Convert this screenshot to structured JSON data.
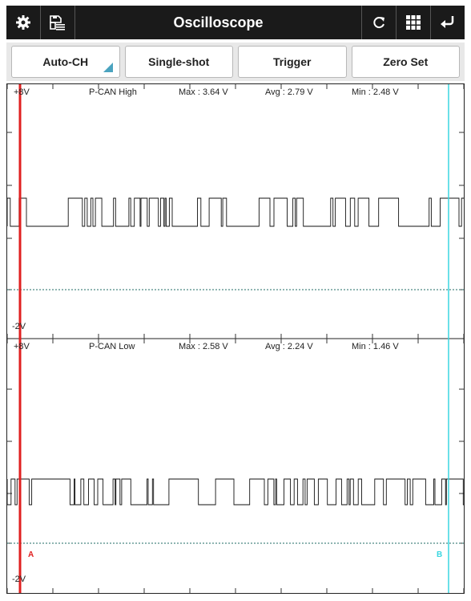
{
  "app": {
    "title": "Oscilloscope"
  },
  "toolbar": {
    "left_icons": [
      "gear-icon",
      "save-list-icon"
    ],
    "right_icons": [
      "refresh-icon",
      "grid-icon",
      "back-icon"
    ]
  },
  "buttons": {
    "auto_ch": "Auto-CH",
    "single_shot": "Single-shot",
    "trigger": "Trigger",
    "zero_set": "Zero Set"
  },
  "channels": [
    {
      "top_label": "+8V",
      "bottom_label": "-2V",
      "name": "P-CAN High",
      "max": "Max : 3.64 V",
      "avg": "Avg : 2.79 V",
      "min": "Min : 2.48 V"
    },
    {
      "top_label": "+8V",
      "bottom_label": "-2V",
      "name": "P-CAN Low",
      "max": "Max : 2.58 V",
      "avg": "Avg : 2.24 V",
      "min": "Min : 1.46 V"
    }
  ],
  "cursors": {
    "a": {
      "label": "A",
      "color": "#e02020"
    },
    "b": {
      "label": "B",
      "color": "#3ad6e0"
    }
  },
  "colors": {
    "trace": "#111111",
    "zero_line": "#1f6b66",
    "grid": "#333333"
  }
}
